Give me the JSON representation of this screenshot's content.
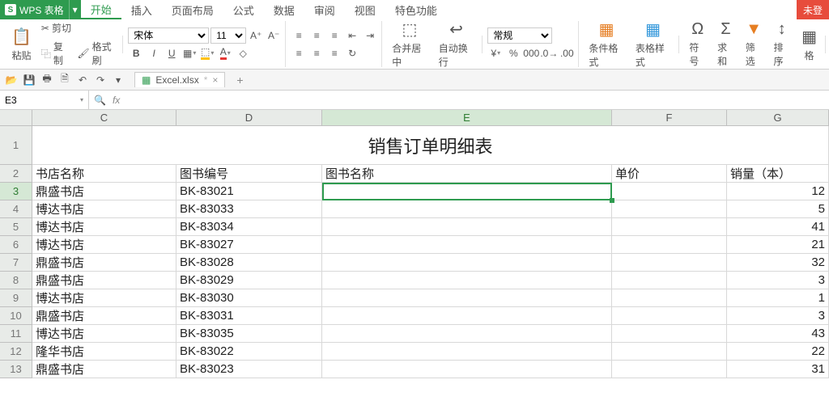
{
  "app": {
    "name": "WPS 表格",
    "login": "未登"
  },
  "menu": {
    "tabs": [
      "开始",
      "插入",
      "页面布局",
      "公式",
      "数据",
      "审阅",
      "视图",
      "特色功能"
    ],
    "active": 0
  },
  "ribbon": {
    "clipboard": {
      "paste": "粘贴",
      "cut": "剪切",
      "copy": "复制",
      "painter": "格式刷"
    },
    "font": {
      "name": "宋体",
      "size": "11",
      "bold": "B",
      "italic": "I",
      "underline": "U"
    },
    "merge": "合并居中",
    "wrap": "自动换行",
    "number_format": "常规",
    "cond": "条件格式",
    "tstyle": "表格样式",
    "symbol": "符号",
    "sum": "求和",
    "filter": "筛选",
    "sort": "排序",
    "fmt": "格"
  },
  "qat": {
    "file": "Excel.xlsx"
  },
  "namebox": "E3",
  "columns": [
    "C",
    "D",
    "E",
    "F",
    "G"
  ],
  "title": "销售订单明细表",
  "headers": {
    "c": "书店名称",
    "d": "图书编号",
    "e": "图书名称",
    "f": "单价",
    "g": "销量（本）"
  },
  "rows": [
    {
      "n": 3,
      "c": "鼎盛书店",
      "d": "BK-83021",
      "g": "12"
    },
    {
      "n": 4,
      "c": "博达书店",
      "d": "BK-83033",
      "g": "5"
    },
    {
      "n": 5,
      "c": "博达书店",
      "d": "BK-83034",
      "g": "41"
    },
    {
      "n": 6,
      "c": "博达书店",
      "d": "BK-83027",
      "g": "21"
    },
    {
      "n": 7,
      "c": "鼎盛书店",
      "d": "BK-83028",
      "g": "32"
    },
    {
      "n": 8,
      "c": "鼎盛书店",
      "d": "BK-83029",
      "g": "3"
    },
    {
      "n": 9,
      "c": "博达书店",
      "d": "BK-83030",
      "g": "1"
    },
    {
      "n": 10,
      "c": "鼎盛书店",
      "d": "BK-83031",
      "g": "3"
    },
    {
      "n": 11,
      "c": "博达书店",
      "d": "BK-83035",
      "g": "43"
    },
    {
      "n": 12,
      "c": "隆华书店",
      "d": "BK-83022",
      "g": "22"
    },
    {
      "n": 13,
      "c": "鼎盛书店",
      "d": "BK-83023",
      "g": "31"
    }
  ]
}
